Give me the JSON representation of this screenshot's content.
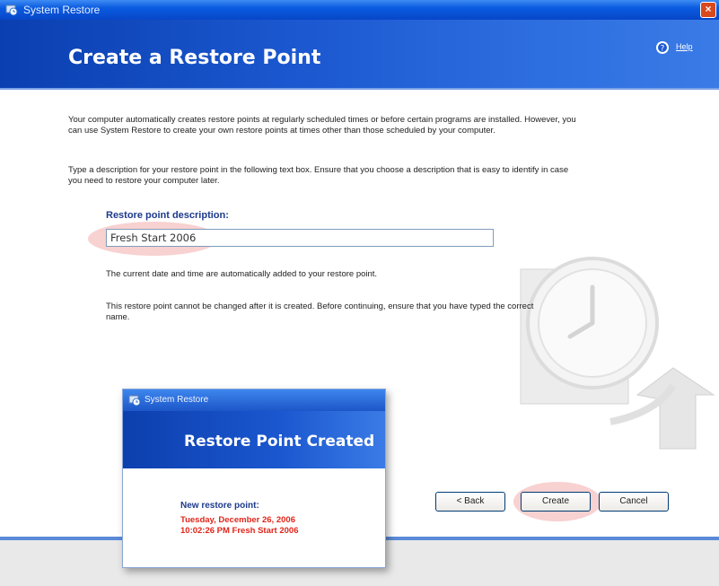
{
  "window": {
    "title": "System Restore",
    "close_glyph": "×"
  },
  "header": {
    "title": "Create a Restore Point",
    "help_label": "Help"
  },
  "content": {
    "intro": "Your computer automatically creates restore points at regularly scheduled times or before certain programs are installed. However, you can use System Restore to create your own restore points at times other than those scheduled by your computer.",
    "instructions": "Type a description for your restore point in the following text box. Ensure that you choose a description that is easy to identify in case you need to restore your computer later.",
    "field_label": "Restore point description:",
    "field_value": "Fresh Start 2006",
    "note_datetime": "The current date and time are automatically added to your restore point.",
    "note_warning": "This restore point cannot be changed after it is created. Before continuing, ensure that you have typed the correct name."
  },
  "buttons": {
    "back": "< Back",
    "create": "Create",
    "cancel": "Cancel"
  },
  "popup": {
    "title": "System Restore",
    "header_title": "Restore Point Created",
    "label": "New restore point:",
    "value_line1": "Tuesday, December 26, 2006",
    "value_line2": "10:02:26 PM  Fresh Start 2006"
  },
  "icons": {
    "titlebar": "system-restore-icon",
    "help": "help-icon",
    "watermark": "clock-restore-icon"
  },
  "colors": {
    "header_blue": "#1d5ad2",
    "highlight": "#e65a5a",
    "label_blue": "#1d3a8c",
    "popup_value_red": "#e0261a"
  }
}
